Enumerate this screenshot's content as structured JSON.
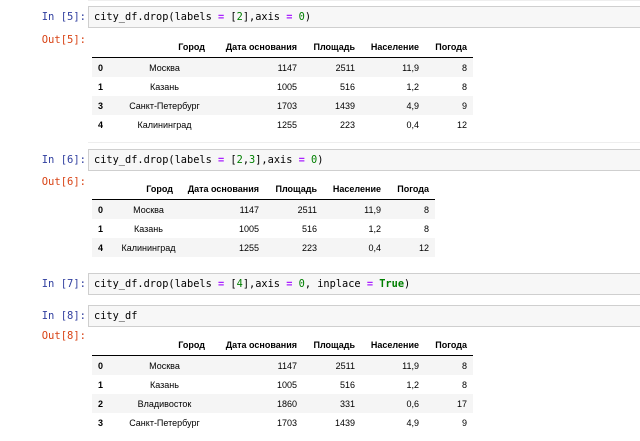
{
  "cells": [
    {
      "in_prompt": "In [5]:",
      "code": {
        "prefix": "city_df.drop(labels ",
        "op1": "=",
        "mid1": " [",
        "n1": "2",
        "mid2": "],axis ",
        "op2": "=",
        "mid3": " ",
        "n2": "0",
        "end": ")"
      },
      "out_prompt": "Out[5]:",
      "table": {
        "columns": [
          "Город",
          "Дата основания",
          "Площадь",
          "Население",
          "Погода"
        ],
        "rows": [
          {
            "index": "0",
            "city": "Москва",
            "founded": "1147",
            "area": "2511",
            "pop": "11,9",
            "weather": "8"
          },
          {
            "index": "1",
            "city": "Казань",
            "founded": "1005",
            "area": "516",
            "pop": "1,2",
            "weather": "8"
          },
          {
            "index": "3",
            "city": "Санкт-Петербург",
            "founded": "1703",
            "area": "1439",
            "pop": "4,9",
            "weather": "9"
          },
          {
            "index": "4",
            "city": "Калининград",
            "founded": "1255",
            "area": "223",
            "pop": "0,4",
            "weather": "12"
          }
        ]
      }
    },
    {
      "in_prompt": "In [6]:",
      "code": {
        "prefix": "city_df.drop(labels ",
        "op1": "=",
        "mid1": " [",
        "n1": "2",
        "mid1b": ",",
        "n1b": "3",
        "mid2": "],axis ",
        "op2": "=",
        "mid3": " ",
        "n2": "0",
        "end": ")"
      },
      "out_prompt": "Out[6]:",
      "table": {
        "columns": [
          "Город",
          "Дата основания",
          "Площадь",
          "Население",
          "Погода"
        ],
        "rows": [
          {
            "index": "0",
            "city": "Москва",
            "founded": "1147",
            "area": "2511",
            "pop": "11,9",
            "weather": "8"
          },
          {
            "index": "1",
            "city": "Казань",
            "founded": "1005",
            "area": "516",
            "pop": "1,2",
            "weather": "8"
          },
          {
            "index": "4",
            "city": "Калининград",
            "founded": "1255",
            "area": "223",
            "pop": "0,4",
            "weather": "12"
          }
        ]
      }
    },
    {
      "in_prompt": "In [7]:",
      "code": {
        "prefix": "city_df.drop(labels ",
        "op1": "=",
        "mid1": " [",
        "n1": "4",
        "mid2": "],axis ",
        "op2": "=",
        "mid3": " ",
        "n2": "0",
        "mid4": ", inplace ",
        "op3": "=",
        "mid5": " ",
        "kw": "True",
        "end": ")"
      }
    },
    {
      "in_prompt": "In [8]:",
      "code": {
        "prefix": "city_df"
      },
      "out_prompt": "Out[8]:",
      "table": {
        "columns": [
          "Город",
          "Дата основания",
          "Площадь",
          "Население",
          "Погода"
        ],
        "rows": [
          {
            "index": "0",
            "city": "Москва",
            "founded": "1147",
            "area": "2511",
            "pop": "11,9",
            "weather": "8"
          },
          {
            "index": "1",
            "city": "Казань",
            "founded": "1005",
            "area": "516",
            "pop": "1,2",
            "weather": "8"
          },
          {
            "index": "2",
            "city": "Владивосток",
            "founded": "1860",
            "area": "331",
            "pop": "0,6",
            "weather": "17"
          },
          {
            "index": "3",
            "city": "Санкт-Петербург",
            "founded": "1703",
            "area": "1439",
            "pop": "4,9",
            "weather": "9"
          }
        ]
      }
    }
  ]
}
